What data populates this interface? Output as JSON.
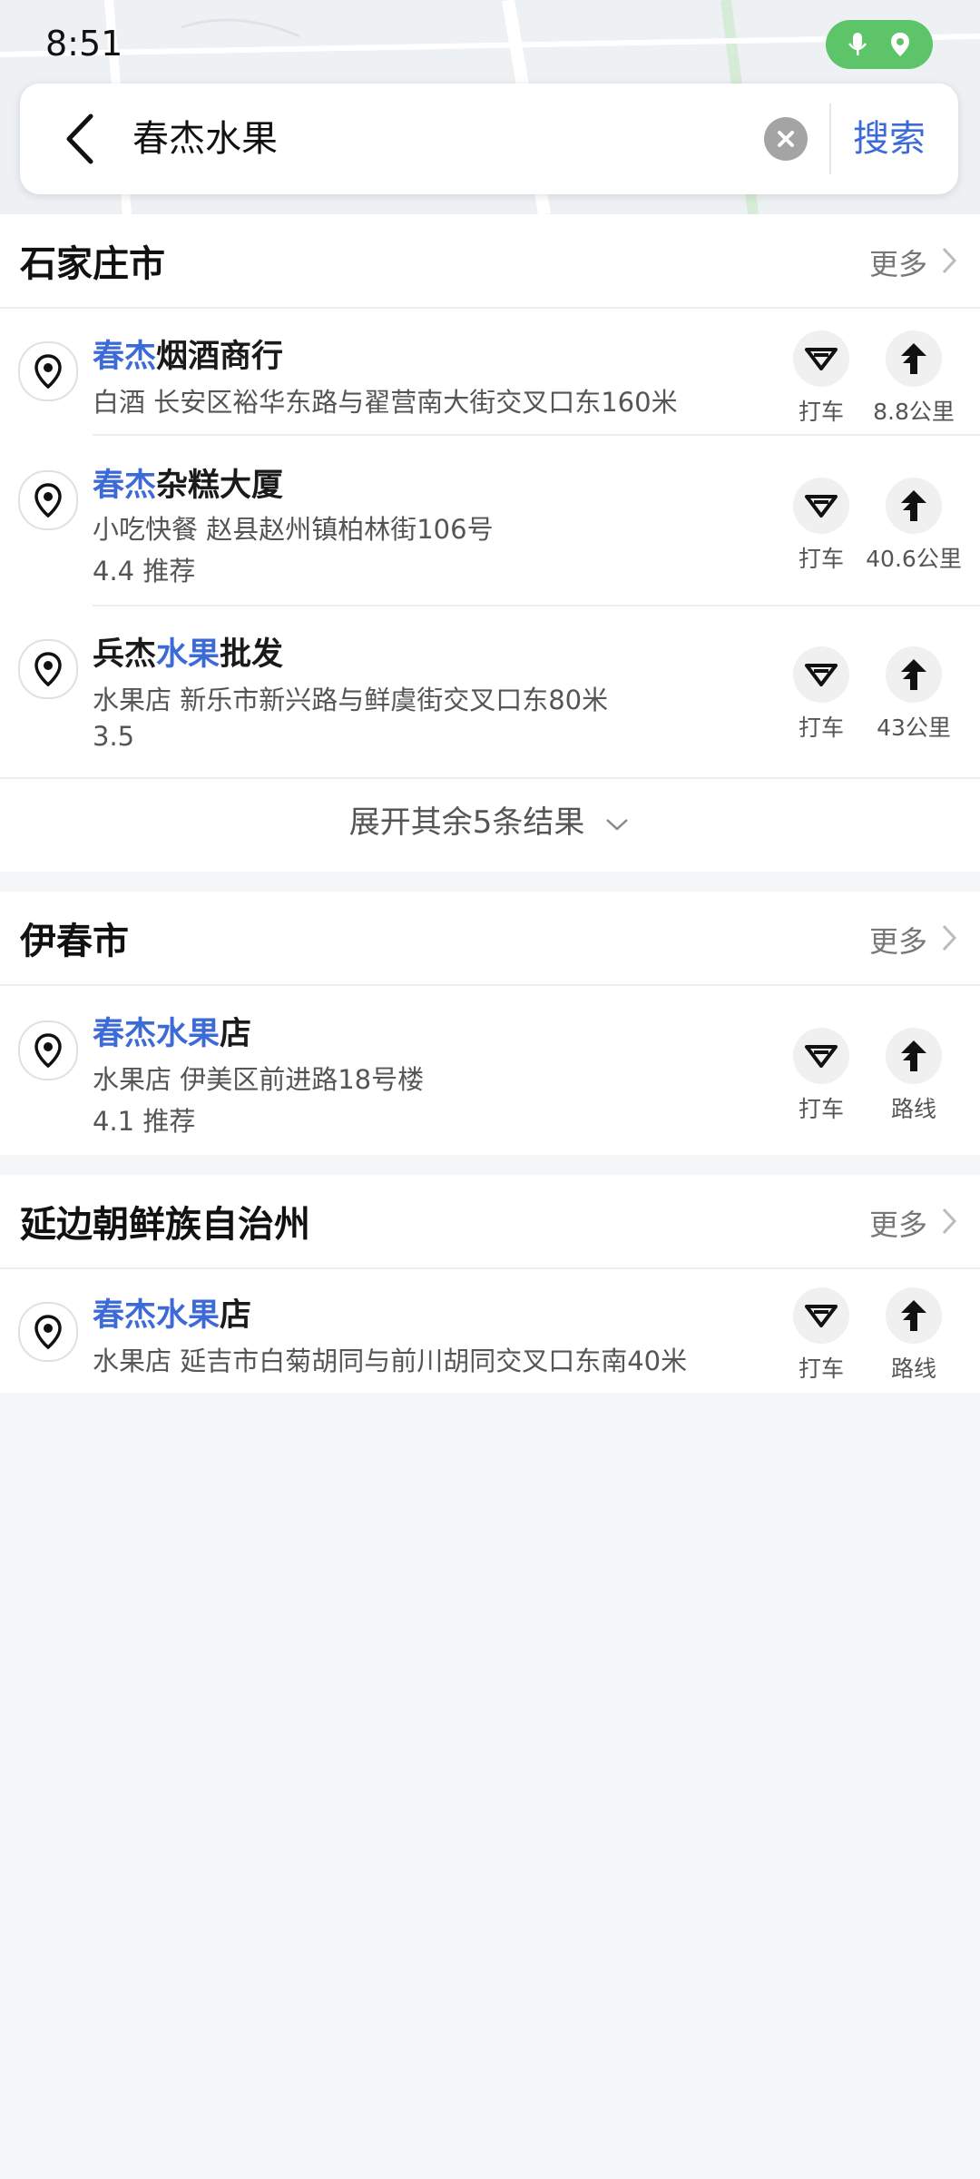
{
  "status_bar": {
    "time": "8:51"
  },
  "search": {
    "query": "春杰水果",
    "search_label": "搜索"
  },
  "expand_text": "展开其余5条结果",
  "sections": [
    {
      "city": "石家庄市",
      "more": "更多",
      "items": [
        {
          "title_hl": "春杰",
          "title_rest": "烟酒商行",
          "subtitle": "白酒   长安区裕华东路与翟营南大街交叉口东160米",
          "rating": "",
          "taxi_label": "打车",
          "route_label": "8.8公里"
        },
        {
          "title_hl": "春杰",
          "title_rest": "杂糕大厦",
          "subtitle": "小吃快餐   赵县赵州镇柏林街106号",
          "rating": "4.4   推荐",
          "taxi_label": "打车",
          "route_label": "40.6公里"
        },
        {
          "title_pre": "兵杰",
          "title_hl": "水果",
          "title_rest": "批发",
          "subtitle": "水果店   新乐市新兴路与鲜虞街交叉口东80米",
          "rating": "3.5",
          "taxi_label": "打车",
          "route_label": "43公里"
        }
      ]
    },
    {
      "city": "伊春市",
      "more": "更多",
      "items": [
        {
          "title_hl": "春杰水果",
          "title_rest": "店",
          "subtitle": "水果店   伊美区前进路18号楼",
          "rating": "4.1   推荐",
          "taxi_label": "打车",
          "route_label": "路线"
        }
      ]
    },
    {
      "city": "延边朝鲜族自治州",
      "more": "更多",
      "items": [
        {
          "title_hl": "春杰水果",
          "title_rest": "店",
          "subtitle": "水果店   延吉市白菊胡同与前川胡同交叉口东南40米",
          "rating": "",
          "taxi_label": "打车",
          "route_label": "路线"
        }
      ]
    }
  ],
  "colors": {
    "accent": "#3c6ad6",
    "status_pill": "#5ec46a",
    "background": "#f5f6f8"
  }
}
